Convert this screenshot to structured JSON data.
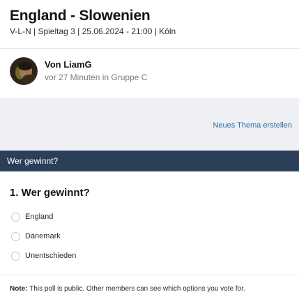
{
  "header": {
    "title": "England - Slowenien",
    "subtitle": "V-L-N | Spieltag 3 | 25.06.2024 - 21:00 | Köln"
  },
  "author": {
    "name": "Von LiamG",
    "meta": "vor 27 Minuten in Gruppe C"
  },
  "actions": {
    "new_thread": "Neues Thema erstellen"
  },
  "poll": {
    "bar_title": "Wer gewinnt?",
    "question": "1. Wer gewinnt?",
    "options": [
      {
        "label": "England",
        "selected": false
      },
      {
        "label": "Dänemark",
        "selected": false
      },
      {
        "label": "Unentschieden",
        "selected": false
      }
    ],
    "note_label": "Note:",
    "note_text": "This poll is public. Other members can see which options you vote for."
  },
  "colors": {
    "poll_bar": "#2b4058",
    "link": "#2f6aa3",
    "band": "#eef0f3"
  }
}
